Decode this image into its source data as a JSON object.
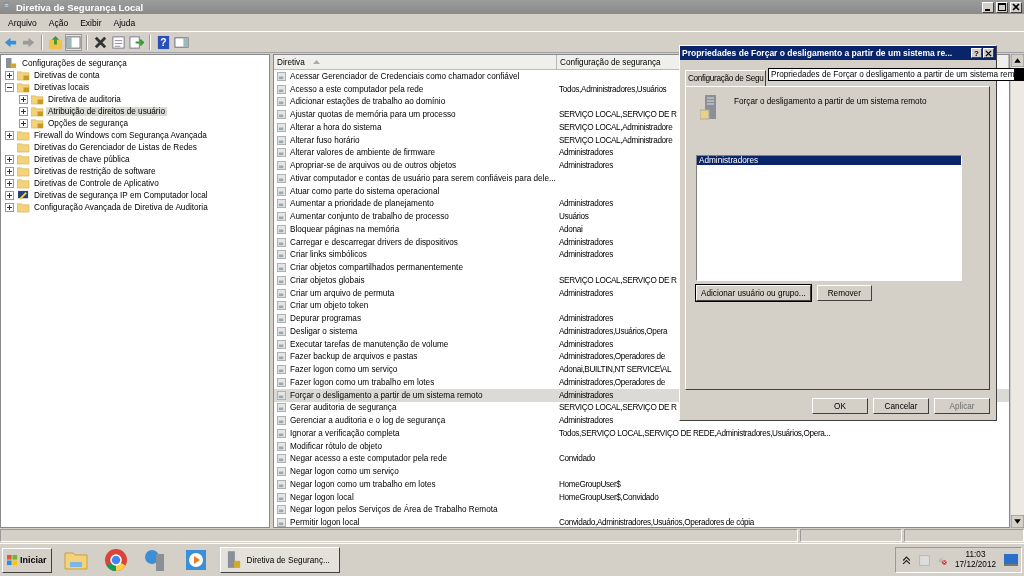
{
  "window": {
    "title": "Diretiva de Segurança Local"
  },
  "menu": [
    "Arquivo",
    "Ação",
    "Exibir",
    "Ajuda"
  ],
  "toolbar": {
    "help_glyph": "?"
  },
  "tree": [
    {
      "label": "Configurações de segurança",
      "kind": "root",
      "selected": false,
      "children": [
        {
          "label": "Diretivas de conta",
          "kind": "locked-folder",
          "expanded": false,
          "selected": false
        },
        {
          "label": "Diretivas locais",
          "kind": "locked-folder",
          "expanded": true,
          "selected": false,
          "children": [
            {
              "label": "Diretiva de auditoria",
              "kind": "locked-folder",
              "expanded": false,
              "selected": false
            },
            {
              "label": "Atribuição de direitos de usuário",
              "kind": "locked-folder",
              "expanded": false,
              "selected": true
            },
            {
              "label": "Opções de segurança",
              "kind": "locked-folder",
              "expanded": false,
              "selected": false
            }
          ]
        },
        {
          "label": "Firewall do Windows com Segurança Avançada",
          "kind": "folder",
          "expanded": false,
          "selected": false
        },
        {
          "label": "Diretivas do Gerenciador de Listas de Redes",
          "kind": "folder",
          "selected": false
        },
        {
          "label": "Diretivas de chave pública",
          "kind": "folder",
          "expanded": false,
          "selected": false
        },
        {
          "label": "Diretivas de restrição de software",
          "kind": "folder",
          "expanded": false,
          "selected": false
        },
        {
          "label": "Diretivas de Controle de Aplicativo",
          "kind": "folder",
          "expanded": false,
          "selected": false
        },
        {
          "label": "Diretivas de segurança IP em Computador local",
          "kind": "ip-policy",
          "expanded": false,
          "selected": false
        },
        {
          "label": "Configuração Avançada de Diretiva de Auditoria",
          "kind": "folder",
          "expanded": false,
          "selected": false
        }
      ]
    }
  ],
  "table": {
    "columns": [
      "Diretiva",
      "Configuração de segurança"
    ],
    "rows": [
      {
        "policy": "Acessar Gerenciador de Credenciais como chamador confiável",
        "selected": false
      },
      {
        "policy": "Acesso a este computador pela rede",
        "setting": "Todos,Administradores,Usuários",
        "selected": false
      },
      {
        "policy": "Adicionar estações de trabalho ao domínio",
        "selected": false
      },
      {
        "policy": "Ajustar quotas de memória para um processo",
        "setting": "SERVIÇO LOCAL,SERVIÇO DE R",
        "selected": false
      },
      {
        "policy": "Alterar a hora do sistema",
        "setting": "SERVIÇO LOCAL,Administradore",
        "selected": false
      },
      {
        "policy": "Alterar fuso horário",
        "setting": "SERVIÇO LOCAL,Administradore",
        "selected": false
      },
      {
        "policy": "Alterar valores de ambiente de firmware",
        "setting": "Administradores",
        "selected": false
      },
      {
        "policy": "Apropriar-se de arquivos ou de outros objetos",
        "setting": "Administradores",
        "selected": false
      },
      {
        "policy": "Ativar computador e contas de usuário para serem confiáveis para dele...",
        "selected": false
      },
      {
        "policy": "Atuar como parte do sistema operacional",
        "selected": false
      },
      {
        "policy": "Aumentar a prioridade de planejamento",
        "setting": "Administradores",
        "selected": false
      },
      {
        "policy": "Aumentar conjunto de trabalho de processo",
        "setting": "Usuários",
        "selected": false
      },
      {
        "policy": "Bloquear páginas na memória",
        "setting": "Adonai",
        "selected": false
      },
      {
        "policy": "Carregar e descarregar drivers de dispositivos",
        "setting": "Administradores",
        "selected": false
      },
      {
        "policy": "Criar links simbólicos",
        "setting": "Administradores",
        "selected": false
      },
      {
        "policy": "Criar objetos compartilhados permanentemente",
        "selected": false
      },
      {
        "policy": "Criar objetos globais",
        "setting": "SERVIÇO LOCAL,SERVIÇO DE R",
        "selected": false
      },
      {
        "policy": "Criar um arquivo de permuta",
        "setting": "Administradores",
        "selected": false
      },
      {
        "policy": "Criar um objeto token",
        "selected": false
      },
      {
        "policy": "Depurar programas",
        "setting": "Administradores",
        "selected": false
      },
      {
        "policy": "Desligar o sistema",
        "setting": "Administradores,Usuários,Opera",
        "selected": false
      },
      {
        "policy": "Executar tarefas de manutenção de volume",
        "setting": "Administradores",
        "selected": false
      },
      {
        "policy": "Fazer backup de arquivos e pastas",
        "setting": "Administradores,Operadores de",
        "selected": false
      },
      {
        "policy": "Fazer logon como um serviço",
        "setting": "Adonai,BUILTIN,NT SERVICE\\AL",
        "selected": false
      },
      {
        "policy": "Fazer logon como um trabalho em lotes",
        "setting": "Administradores,Operadores de",
        "selected": false
      },
      {
        "policy": "Forçar o desligamento a partir de um sistema remoto",
        "setting": "Administradores",
        "selected": true
      },
      {
        "policy": "Gerar auditoria de segurança",
        "setting": "SERVIÇO LOCAL,SERVIÇO DE R",
        "selected": false
      },
      {
        "policy": "Gerenciar a auditoria e o log de segurança",
        "setting": "Administradores",
        "selected": false
      },
      {
        "policy": "Ignorar a verificação completa",
        "setting": "Todos,SERVIÇO LOCAL,SERVIÇO DE REDE,Administradores,Usuários,Opera...",
        "selected": false
      },
      {
        "policy": "Modificar rótulo de objeto",
        "selected": false
      },
      {
        "policy": "Negar acesso a este computador pela rede",
        "setting": "Convidado",
        "selected": false
      },
      {
        "policy": "Negar logon como um serviço",
        "selected": false
      },
      {
        "policy": "Negar logon como um trabalho em lotes",
        "setting": "HomeGroupUser$",
        "selected": false
      },
      {
        "policy": "Negar logon local",
        "setting": "HomeGroupUser$,Convidado",
        "selected": false
      },
      {
        "policy": "Negar logon pelos Serviços de Área de Trabalho Remota",
        "selected": false
      },
      {
        "policy": "Permitir logon local",
        "setting": "Convidado,Administradores,Usuários,Operadores de cópia",
        "selected": false
      }
    ]
  },
  "dialog": {
    "title": "Propriedades de Forçar o desligamento a partir de um sistema re...",
    "help_glyph": "?",
    "tab": "Configuração de Segu",
    "policy": "Forçar o desligamento a partir de um sistema remoto",
    "members": [
      {
        "name": "Administradores",
        "selected": true
      }
    ],
    "buttons": [
      {
        "label": "Adicionar usuário ou grupo...",
        "disabled": false
      },
      {
        "label": "Remover",
        "disabled": false
      }
    ],
    "footer": [
      {
        "label": "OK",
        "disabled": false
      },
      {
        "label": "Cancelar",
        "disabled": false
      },
      {
        "label": "Aplicar",
        "disabled": true
      }
    ]
  },
  "tooltip": "Propriedades de Forçar o desligamento a partir de um sistema rem",
  "taskbar": {
    "start": "Iniciar",
    "task": "Diretiva de Seguranç...",
    "time": "11:03",
    "date": "17/12/2012"
  }
}
